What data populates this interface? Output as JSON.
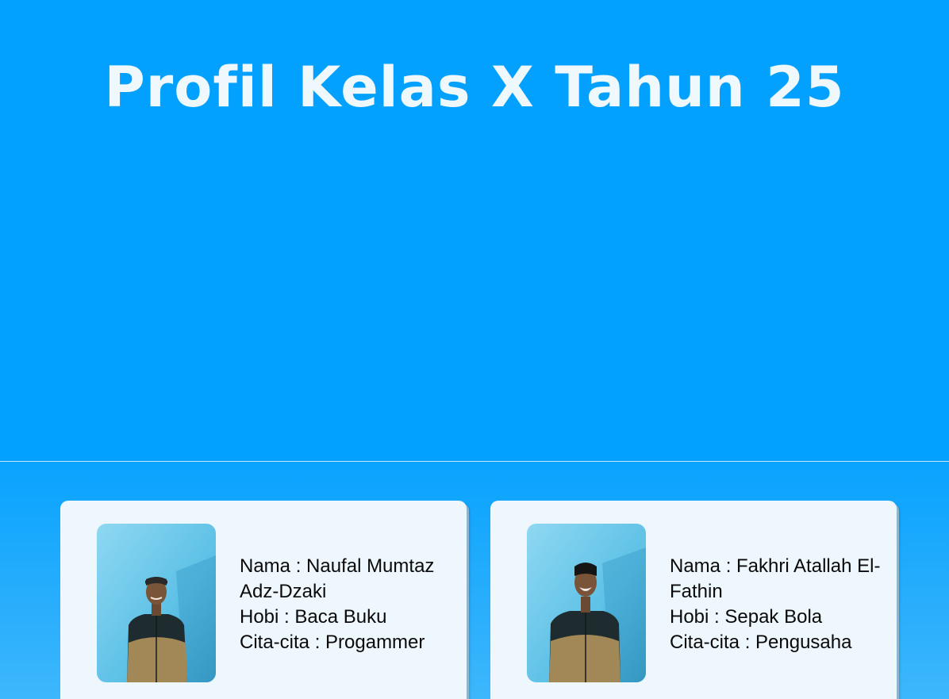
{
  "header": {
    "title": "Profil Kelas X Tahun 25"
  },
  "profiles": [
    {
      "name_line": "Nama : Naufal Mumtaz Adz-Dzaki",
      "hobby_line": "Hobi : Baca Buku",
      "goal_line": "Cita-cita : Progammer"
    },
    {
      "name_line": "Nama : Fakhri Atallah El-Fathin",
      "hobby_line": "Hobi : Sepak Bola",
      "goal_line": "Cita-cita : Pengusaha"
    }
  ],
  "colors": {
    "hero_background": "#02a0ff",
    "title_text": "#eef8fd",
    "card_background": "#eef7fd",
    "photo_background": "#6ec9ea",
    "shirt_top": "#1e2b2e",
    "shirt_bottom": "#a18656"
  }
}
